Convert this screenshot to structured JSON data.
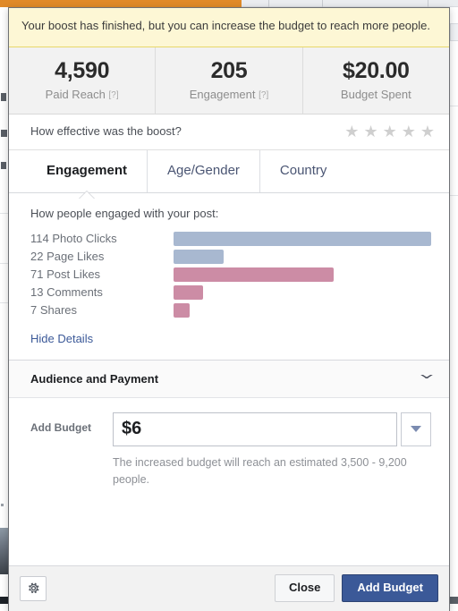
{
  "backdrop": {
    "progress_fill_color": "#e08a28",
    "progress_track_color": "#ebedf0"
  },
  "dialog": {
    "notice": {
      "text": "Your boost has finished, but you can increase the budget to reach more people.",
      "background_color": "#fdf7d5",
      "border_color": "#e8d86a"
    },
    "stats": [
      {
        "value": "4,590",
        "label": "Paid Reach",
        "help": "[?]",
        "has_help": true
      },
      {
        "value": "205",
        "label": "Engagement",
        "help": "[?]",
        "has_help": true
      },
      {
        "value": "$20.00",
        "label": "Budget Spent",
        "help": "",
        "has_help": false
      }
    ],
    "rating": {
      "question": "How effective was the boost?",
      "star_glyph": "★",
      "star_count": 5,
      "stars_filled": 0,
      "star_color": "#cfcfcf"
    },
    "tabs": [
      {
        "label": "Engagement",
        "active": true
      },
      {
        "label": "Age/Gender",
        "active": false
      },
      {
        "label": "Country",
        "active": false
      }
    ],
    "engagement": {
      "heading": "How people engaged with your post:",
      "hide_details_label": "Hide Details"
    },
    "audience": {
      "title": "Audience and Payment",
      "chevron_icon": "chevron-down-icon"
    },
    "budget": {
      "label": "Add Budget",
      "value": "$6",
      "placeholder": "$6",
      "hint": "The increased budget will reach an estimated 3,500 - 9,200 people.",
      "dropdown_icon": "caret-down-icon"
    },
    "footer": {
      "gear_icon": "gear-icon",
      "close_label": "Close",
      "add_budget_label": "Add Budget",
      "primary_color": "#3b5998"
    }
  },
  "chart_data": {
    "type": "bar",
    "title": "How people engaged with your post:",
    "orientation": "horizontal",
    "xlabel": "",
    "ylabel": "",
    "grid": false,
    "legend": null,
    "xlim": [
      0,
      114
    ],
    "categories": [
      "Photo Clicks",
      "Page Likes",
      "Post Likes",
      "Comments",
      "Shares"
    ],
    "values": [
      114,
      22,
      71,
      13,
      7
    ],
    "labels": [
      "114 Photo Clicks",
      "22 Page Likes",
      "71 Post Likes",
      "13 Comments",
      "7 Shares"
    ],
    "colors": [
      "#a8b8d0",
      "#a8b8d0",
      "#cc8ca5",
      "#cc8ca5",
      "#cc8ca5"
    ],
    "bar_widths_pct": [
      100,
      19.3,
      62.3,
      11.4,
      6.1
    ]
  }
}
